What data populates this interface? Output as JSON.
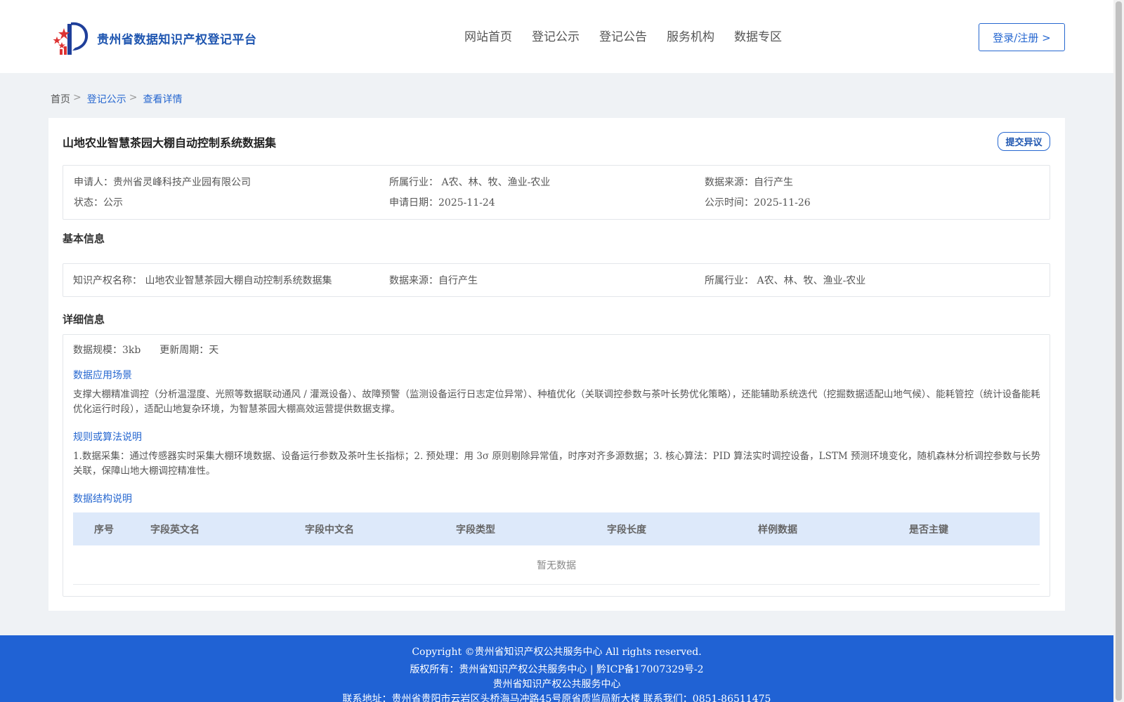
{
  "header": {
    "brand": "贵州省数据知识产权登记平台",
    "nav": [
      "网站首页",
      "登记公示",
      "登记公告",
      "服务机构",
      "数据专区"
    ],
    "login_label": "登录/注册 >"
  },
  "breadcrumb": {
    "home": "首页",
    "sep": ">",
    "items": [
      "登记公示",
      "查看详情"
    ]
  },
  "detail": {
    "title": "山地农业智慧茶园大棚自动控制系统数据集",
    "objection_label": "提交异议",
    "summary": {
      "applicant_label": "申请人：",
      "applicant": "贵州省灵峰科技产业园有限公司",
      "industry_label": "所属行业：",
      "industry": "A农、林、牧、渔业-农业",
      "source_label": "数据来源：",
      "source": "自行产生",
      "status_label": "状态：",
      "status": "公示",
      "apply_date_label": "申请日期：",
      "apply_date": "2025-11-24",
      "publish_label": "公示时间：",
      "publish_date": "2025-11-26"
    },
    "basic_title": "基本信息",
    "basic": {
      "ip_name_label": "知识产权名称：",
      "ip_name": "山地农业智慧茶园大棚自动控制系统数据集",
      "source_label": "数据来源：",
      "source": "自行产生",
      "industry_label": "所属行业：",
      "industry": "A农、林、牧、渔业-农业"
    },
    "detail_title": "详细信息",
    "detail_info": {
      "scale_label": "数据规模：",
      "scale": "3kb",
      "cycle_label": "更新周期：",
      "cycle": "天",
      "scenario_title": "数据应用场景",
      "scenario_text": "支撑大棚精准调控（分析温湿度、光照等数据联动通风 / 灌溉设备）、故障预警（监测设备运行日志定位异常）、种植优化（关联调控参数与茶叶长势优化策略），还能辅助系统迭代（挖掘数据适配山地气候）、能耗管控（统计设备能耗优化运行时段），适配山地复杂环境，为智慧茶园大棚高效运营提供数据支撑。",
      "algo_title": "规则或算法说明",
      "algo_text": "1.数据采集：通过传感器实时采集大棚环境数据、设备运行参数及茶叶生长指标；2. 预处理：用 3σ 原则剔除异常值，时序对齐多源数据；3. 核心算法：PID 算法实时调控设备，LSTM 预测环境变化，随机森林分析调控参数与长势关联，保障山地大棚调控精准性。",
      "structure_title": "数据结构说明",
      "columns": [
        "序号",
        "字段英文名",
        "字段中文名",
        "字段类型",
        "字段长度",
        "样例数据",
        "是否主键"
      ],
      "empty_text": "暂无数据"
    }
  },
  "footer": {
    "line1": "Copyright ©贵州省知识产权公共服务中心 All rights reserved.",
    "line2": "版权所有：贵州省知识产权公共服务中心 | 黔ICP备17007329号-2",
    "line3": "贵州省知识产权公共服务中心",
    "line4": "联系地址：贵州省贵阳市云岩区头桥海马冲路45号原省质监局新大楼 联系我们：0851-86511475"
  },
  "colors": {
    "accent": "#2667d0",
    "footer_bg": "#2062d4",
    "table_head_bg": "#dde9fa",
    "page_bg": "#eff2f5"
  }
}
